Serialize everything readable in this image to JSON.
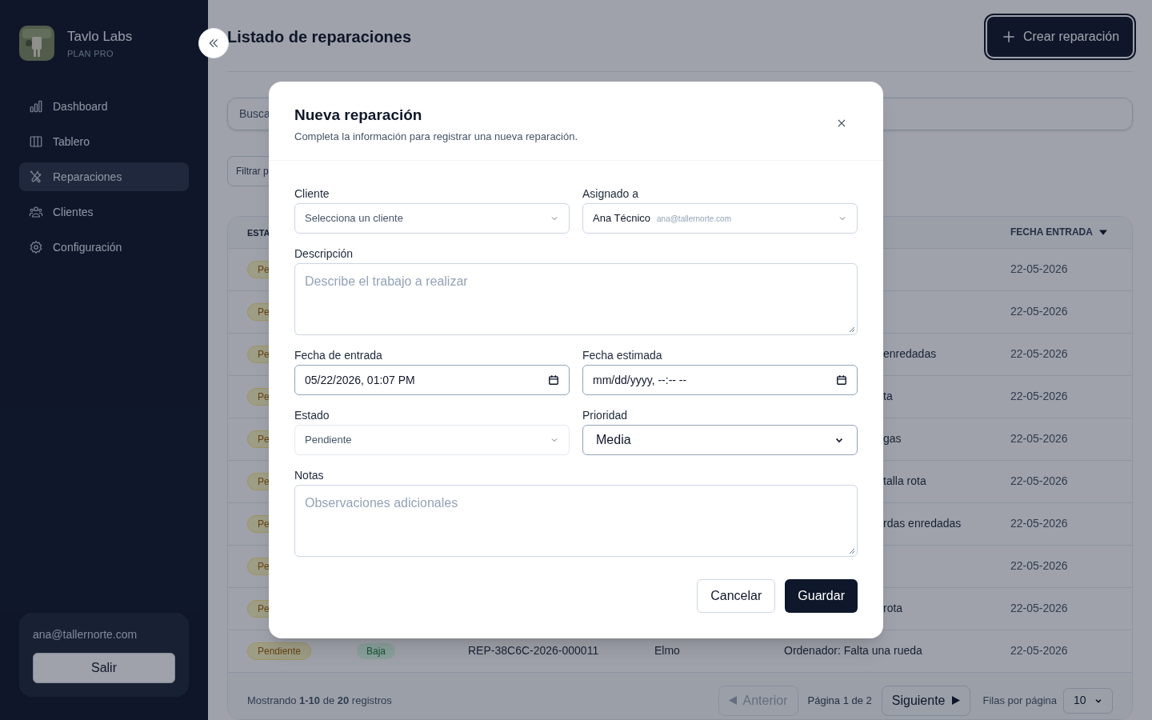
{
  "sidebar": {
    "brand": {
      "name": "Tavlo Labs",
      "plan": "PLAN PRO"
    },
    "items": [
      {
        "label": "Dashboard",
        "kind": "chart",
        "selected": false
      },
      {
        "label": "Tablero",
        "kind": "columns",
        "selected": false
      },
      {
        "label": "Reparaciones",
        "kind": "tools",
        "selected": true
      },
      {
        "label": "Clientes",
        "kind": "users",
        "selected": false
      },
      {
        "label": "Configuración",
        "kind": "gear",
        "selected": false
      }
    ],
    "user": {
      "email": "ana@tallernorte.com",
      "logout": "Salir"
    }
  },
  "header": {
    "title": "Listado de reparaciones",
    "create_button": "Crear reparación"
  },
  "toolbar": {
    "search": {
      "placeholder": "Busca"
    },
    "filter": {
      "placeholder": "Filtrar p"
    }
  },
  "table": {
    "columns": [
      {
        "label": "ESTA"
      },
      {
        "label": "FECHA ENTRADA",
        "sorted": true
      }
    ],
    "rows": [
      {
        "status": "Pe",
        "date": "22-05-2026"
      },
      {
        "status": "Pe",
        "date": "22-05-2026"
      },
      {
        "status": "Pe",
        "description": "enredadas",
        "date": "22-05-2026"
      },
      {
        "status": "Pe",
        "description": "ta",
        "date": "22-05-2026"
      },
      {
        "status": "Pe",
        "description": "gas",
        "date": "22-05-2026"
      },
      {
        "status": "Pe",
        "description": "talla rota",
        "date": "22-05-2026"
      },
      {
        "status": "Pe",
        "description": "rdas enredadas",
        "date": "22-05-2026"
      },
      {
        "status": "Pe",
        "date": "22-05-2026"
      },
      {
        "status": "Pe",
        "description": "rota",
        "date": "22-05-2026"
      },
      {
        "status": "Pendiente",
        "priority": "Baja",
        "code": "REP-38C6C-2026-000011",
        "client": "Elmo",
        "description": "Ordenador: Falta una rueda",
        "date": "22-05-2026"
      }
    ]
  },
  "pagination": {
    "summary": "Mostrando **1-10** de **20** registros",
    "previous": {
      "label": "Anterior",
      "disabled": true
    },
    "page": "Página 1 de 2",
    "next": {
      "label": "Siguiente",
      "disabled": false
    },
    "rows_label": "Filas por página",
    "rows_value": "10"
  },
  "modal": {
    "title": "Nueva reparación",
    "subtitle": "Completa la información para registrar una nueva reparación.",
    "fields": [
      {
        "kind": "select",
        "label": "Cliente",
        "placeholder": "Selecciona un cliente"
      },
      {
        "kind": "user-select",
        "label": "Asignado a",
        "value": "Ana Técnico",
        "secondary": "ana@tallernorte.com"
      },
      {
        "kind": "textarea",
        "label": "Descripción",
        "placeholder": "Describe el trabajo a realizar"
      },
      {
        "kind": "datetime",
        "label": "Fecha de entrada",
        "value": "05/22/2026, 01:07 PM"
      },
      {
        "kind": "datetime",
        "label": "Fecha estimada",
        "value": "mm/dd/yyyy, --:-- --"
      },
      {
        "kind": "select",
        "label": "Estado",
        "value": "Pendiente"
      },
      {
        "kind": "native-select",
        "label": "Prioridad",
        "value": "Media"
      },
      {
        "kind": "textarea",
        "label": "Notas",
        "placeholder": "Observaciones adicionales"
      }
    ],
    "cancel": "Cancelar",
    "save": "Guardar"
  }
}
